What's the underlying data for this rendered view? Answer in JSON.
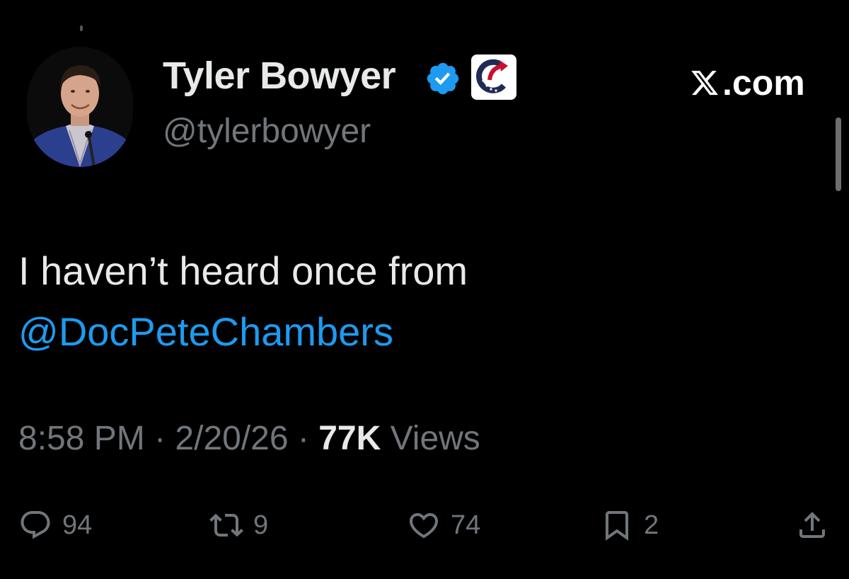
{
  "author": {
    "display_name": "Tyler Bowyer",
    "handle": "@tylerbowyer",
    "verified_icon": "verified-badge-icon",
    "affiliate_icon": "affiliate-badge-icon"
  },
  "source": {
    "label": ".com",
    "icon": "x-logo-icon"
  },
  "tweet": {
    "text": "I haven’t heard once from",
    "mention": "@DocPeteChambers"
  },
  "meta": {
    "time": "8:58 PM",
    "separator": " · ",
    "date": "2/20/26",
    "views_count": "77K",
    "views_label": " Views"
  },
  "actions": {
    "replies": "94",
    "reposts": "9",
    "likes": "74",
    "bookmarks": "2"
  },
  "colors": {
    "background": "#000000",
    "primary_text": "#e7e9ea",
    "secondary_text": "#71767b",
    "link": "#1d9bf0",
    "verified": "#1d9bf0"
  }
}
